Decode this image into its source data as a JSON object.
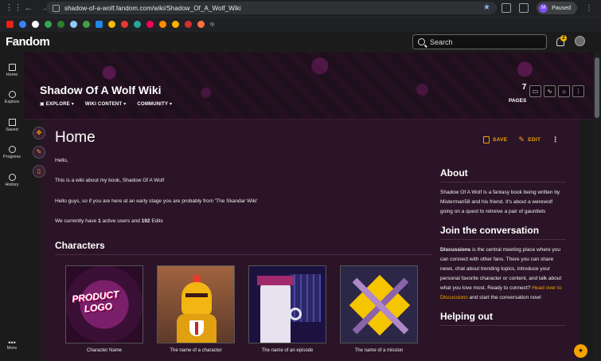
{
  "browser": {
    "url": "shadow-of-a-wolf.fandom.com/wiki/Shadow_Of_A_Wolf_Wiki",
    "profile_initial": "M",
    "profile_status": "Paused",
    "bookmark_label": "rp"
  },
  "fandom": {
    "logo": "Fandom",
    "search_placeholder": "Search",
    "notification_count": "2"
  },
  "rail": {
    "items": [
      {
        "label": "Home",
        "icon": "home-icon"
      },
      {
        "label": "Explore",
        "icon": "compass-icon"
      },
      {
        "label": "Saved",
        "icon": "bookmark-icon"
      },
      {
        "label": "Progress",
        "icon": "check-circle-icon"
      },
      {
        "label": "History",
        "icon": "history-icon"
      },
      {
        "label": "More",
        "icon": "more-icon"
      }
    ]
  },
  "wiki": {
    "title": "Shadow Of A Wolf Wiki",
    "nav": [
      "EXPLORE",
      "WIKI CONTENT",
      "COMMUNITY"
    ],
    "pages_count": "7",
    "pages_label": "PAGES"
  },
  "page": {
    "title": "Home",
    "save_label": "SAVE",
    "edit_label": "EDIT",
    "paragraphs": {
      "p1": "Hello,",
      "p2": "This is a wiki about my book, Shadow Of A Wolf",
      "p3": "Hello guys, so if you are here at an early stage you are probably from 'The Skandar Wiki'",
      "p4_pre": "We currently have ",
      "p4_users": "1",
      "p4_mid": " active users and ",
      "p4_edits": "192",
      "p4_post": " Edits"
    },
    "characters_heading": "Characters",
    "gallery": [
      {
        "caption": "Character Name",
        "logo_line1": "PRODUCT",
        "logo_line2": "LOGO"
      },
      {
        "caption": "The name of a character"
      },
      {
        "caption": "The name of an episode"
      },
      {
        "caption": "The name of a mission"
      }
    ]
  },
  "sidebar": {
    "about_heading": "About",
    "about_text": "Shadow Of A Wolf is a fantasy book being written by Misterman58 and his friend. It's about a werewolf going on a quest to retreive a pair of gauntlets",
    "join_heading": "Join the conversation",
    "join_bold": "Discussions",
    "join_text": " is the central meeting place where you can connect with other fans. There you can share news, chat about trending topics, introduce your personal favorite character or content, and talk about what you love most. Ready to connect? ",
    "join_link": "Head over to Discussions",
    "join_end": " and start the conversation now!",
    "helping_heading": "Helping out"
  },
  "colors": {
    "accent": "#f5a300",
    "page_bg": "#2b1427",
    "brand": "#fa005a"
  }
}
